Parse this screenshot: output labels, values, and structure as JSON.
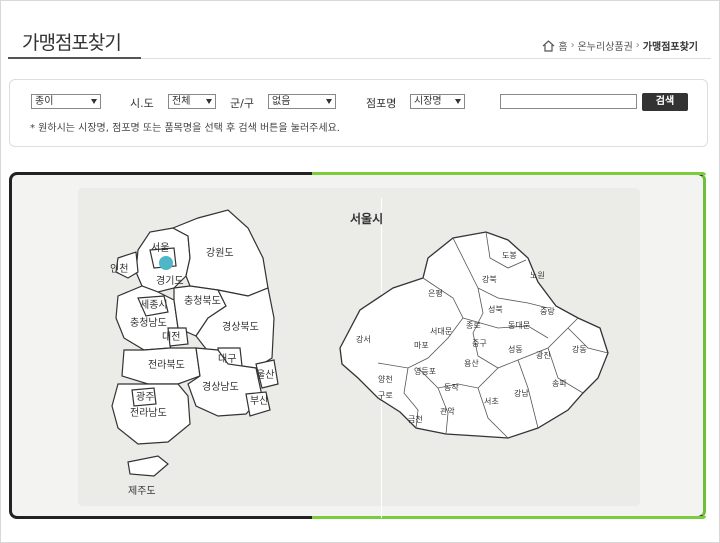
{
  "header": {
    "title": "가맹점포찾기",
    "breadcrumb": [
      "홈",
      "온누리상품권",
      "가맹점포찾기"
    ]
  },
  "search": {
    "category_select": "종이",
    "sido_label": "시.도",
    "sido_select": "전체",
    "gungu_label": "군/구",
    "gungu_select": "없음",
    "store_label": "점포명",
    "store_select": "시장명",
    "query_value": "",
    "button_label": "검색",
    "note": "* 원하시는 시장명, 점포명 또는 품목명을 선택 후 검색 버튼을 눌러주세요."
  },
  "korea_map": {
    "regions": [
      {
        "id": "seoul",
        "label": "서울"
      },
      {
        "id": "incheon",
        "label": "인천"
      },
      {
        "id": "gyeonggi",
        "label": "경기도"
      },
      {
        "id": "gangwon",
        "label": "강원도"
      },
      {
        "id": "sejong",
        "label": "세종시"
      },
      {
        "id": "chungbuk",
        "label": "충청북도"
      },
      {
        "id": "chungnam",
        "label": "충청남도"
      },
      {
        "id": "daejeon",
        "label": "대전"
      },
      {
        "id": "gyeongbuk",
        "label": "경상북도"
      },
      {
        "id": "jeonbuk",
        "label": "전라북도"
      },
      {
        "id": "daegu",
        "label": "대구"
      },
      {
        "id": "ulsan",
        "label": "울산"
      },
      {
        "id": "gyeongnam",
        "label": "경상남도"
      },
      {
        "id": "busan",
        "label": "부산"
      },
      {
        "id": "gwangju",
        "label": "광주"
      },
      {
        "id": "jeonnam",
        "label": "전라남도"
      },
      {
        "id": "jeju",
        "label": "제주도"
      }
    ],
    "selected": "서울",
    "marker_color": "#4fb6c8"
  },
  "seoul_map": {
    "title": "서울시",
    "districts": [
      {
        "id": "dobong",
        "label": "도봉"
      },
      {
        "id": "nowon",
        "label": "노원"
      },
      {
        "id": "gangbuk",
        "label": "강북"
      },
      {
        "id": "eunpyeong",
        "label": "은평"
      },
      {
        "id": "seongbuk",
        "label": "성북"
      },
      {
        "id": "jungnang",
        "label": "중랑"
      },
      {
        "id": "jongno",
        "label": "종로"
      },
      {
        "id": "dongdaemun",
        "label": "동대문"
      },
      {
        "id": "seodaemun",
        "label": "서대문"
      },
      {
        "id": "gangseo",
        "label": "강서"
      },
      {
        "id": "mapo",
        "label": "마포"
      },
      {
        "id": "junggu",
        "label": "중구"
      },
      {
        "id": "seongdong",
        "label": "성동"
      },
      {
        "id": "gwangjin",
        "label": "광진"
      },
      {
        "id": "gangdong",
        "label": "강동"
      },
      {
        "id": "yongsan",
        "label": "용산"
      },
      {
        "id": "yeongdeungpo",
        "label": "영등포"
      },
      {
        "id": "yangcheon",
        "label": "양천"
      },
      {
        "id": "guro",
        "label": "구로"
      },
      {
        "id": "dongjak",
        "label": "동작"
      },
      {
        "id": "gangnam",
        "label": "강남"
      },
      {
        "id": "songpa",
        "label": "송파"
      },
      {
        "id": "seocho",
        "label": "서초"
      },
      {
        "id": "gwanak",
        "label": "관악"
      },
      {
        "id": "geumcheon",
        "label": "금천"
      }
    ]
  }
}
